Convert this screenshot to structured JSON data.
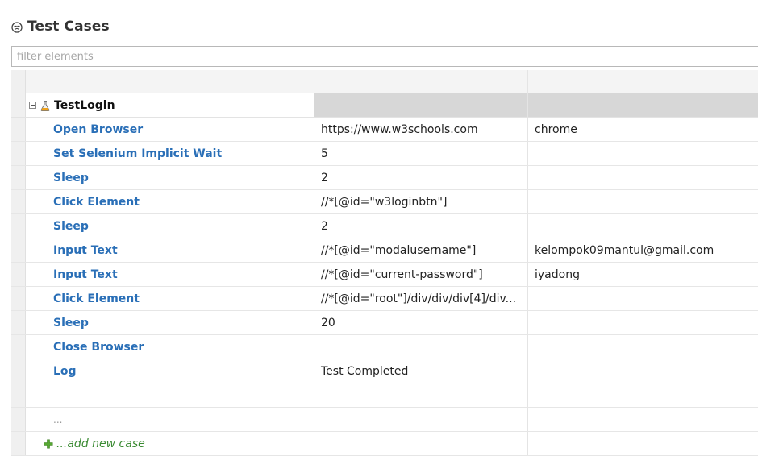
{
  "panel": {
    "title": "Test Cases",
    "filter_placeholder": "filter elements"
  },
  "test_case": {
    "name": "TestLogin",
    "steps": [
      {
        "keyword": "Open Browser",
        "arg1": "https://www.w3schools.com",
        "arg2": "chrome"
      },
      {
        "keyword": "Set Selenium Implicit Wait",
        "arg1": "5",
        "arg2": ""
      },
      {
        "keyword": "Sleep",
        "arg1": "2",
        "arg2": ""
      },
      {
        "keyword": "Click Element",
        "arg1": "//*[@id=\"w3loginbtn\"]",
        "arg2": ""
      },
      {
        "keyword": "Sleep",
        "arg1": "2",
        "arg2": ""
      },
      {
        "keyword": "Input Text",
        "arg1": "//*[@id=\"modalusername\"]",
        "arg2": "kelompok09mantul@gmail.com"
      },
      {
        "keyword": "Input Text",
        "arg1": "//*[@id=\"current-password\"]",
        "arg2": "iyadong"
      },
      {
        "keyword": "Click Element",
        "arg1": "//*[@id=\"root\"]/div/div/div[4]/div...",
        "arg2": ""
      },
      {
        "keyword": "Sleep",
        "arg1": "20",
        "arg2": ""
      },
      {
        "keyword": "Close Browser",
        "arg1": "",
        "arg2": ""
      },
      {
        "keyword": "Log",
        "arg1": "Test Completed",
        "arg2": ""
      }
    ]
  },
  "ellipsis_label": "...",
  "add_new_case_label": "...add new case",
  "icons": {
    "panel": "test-cases-icon",
    "collapse": "collapse-toggle-icon",
    "test_case": "flask-icon",
    "add": "green-plus-icon"
  },
  "colors": {
    "keyword": "#2a6fb7",
    "add_link": "#3a8a32",
    "header_band": "#d7d7d7"
  }
}
